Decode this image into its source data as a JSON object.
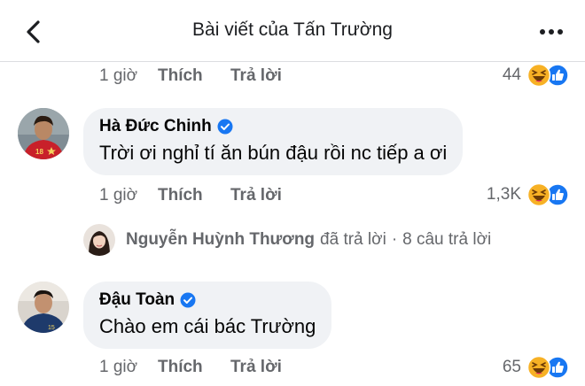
{
  "header": {
    "title": "Bài viết của Tấn Trường"
  },
  "comments": [
    {
      "time": "1 giờ",
      "like_label": "Thích",
      "reply_label": "Trả lời",
      "reaction_count": "44"
    },
    {
      "author": "Hà Đức Chinh",
      "text": "Trời ơi nghỉ tí ăn bún đậu rồi nc tiếp a ơi",
      "time": "1 giờ",
      "like_label": "Thích",
      "reply_label": "Trả lời",
      "reaction_count": "1,3K"
    },
    {
      "author": "Đậu Toàn",
      "text": "Chào em cái bác Trường",
      "time": "1 giờ",
      "like_label": "Thích",
      "reply_label": "Trả lời",
      "reaction_count": "65"
    }
  ],
  "replies_preview": {
    "author": "Nguyễn Huỳnh Thương",
    "action": "đã trả lời",
    "separator": "·",
    "count_label": "8 câu trả lời"
  },
  "colors": {
    "verified": "#1877f2",
    "like_blue": "#1877f2",
    "haha_yellow": "#f7b125",
    "bubble_bg": "#f0f2f5",
    "secondary_text": "#65676b"
  },
  "icons": {
    "back": "chevron-left-icon",
    "more": "more-horizontal-icon",
    "verified": "verified-badge-icon",
    "haha": "haha-reaction-icon",
    "like": "like-reaction-icon"
  }
}
